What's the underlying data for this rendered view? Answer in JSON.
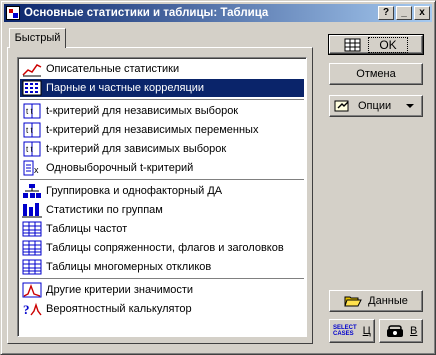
{
  "window": {
    "title": "Основные статистики и таблицы: Таблица"
  },
  "titlebar_buttons": {
    "help": "?",
    "minimize": "_",
    "close": "x"
  },
  "tab": {
    "label": "Быстрый"
  },
  "list": {
    "items": [
      {
        "label": "Описательные статистики",
        "icon": "descriptive-stats-icon"
      },
      {
        "label": "Парные и частные корреляции",
        "icon": "correlation-matrix-icon",
        "selected": true
      },
      {
        "label": "t-критерий для независимых выборок",
        "icon": "t-test-independent-icon"
      },
      {
        "label": "t-критерий для независимых переменных",
        "icon": "t-test-variables-icon"
      },
      {
        "label": "t-критерий для зависимых выборок",
        "icon": "t-test-dependent-icon"
      },
      {
        "label": "Одновыборочный t-критерий",
        "icon": "single-sample-t-icon"
      },
      {
        "label": "Группировка и однофакторный ДА",
        "icon": "grouping-icon"
      },
      {
        "label": "Статистики по группам",
        "icon": "group-stats-icon"
      },
      {
        "label": "Таблицы частот",
        "icon": "frequency-table-icon"
      },
      {
        "label": "Таблицы сопряженности, флагов и заголовков",
        "icon": "crosstab-icon"
      },
      {
        "label": "Таблицы многомерных откликов",
        "icon": "multiple-response-icon"
      },
      {
        "label": "Другие критерии значимости",
        "icon": "significance-icon"
      },
      {
        "label": "Вероятностный калькулятор",
        "icon": "probability-calculator-icon"
      }
    ]
  },
  "buttons": {
    "ok": "OK",
    "cancel": "Отмена",
    "options": "Опции",
    "data": "Данные",
    "select_cases_line1": "SELECT",
    "select_cases_line2": "CASES",
    "select_cases_key": "Ц",
    "weight_key": "В"
  },
  "colors": {
    "selection": "#0a246a",
    "face": "#d4d0c8",
    "title_start": "#0a246a",
    "title_end": "#a6caf0"
  }
}
